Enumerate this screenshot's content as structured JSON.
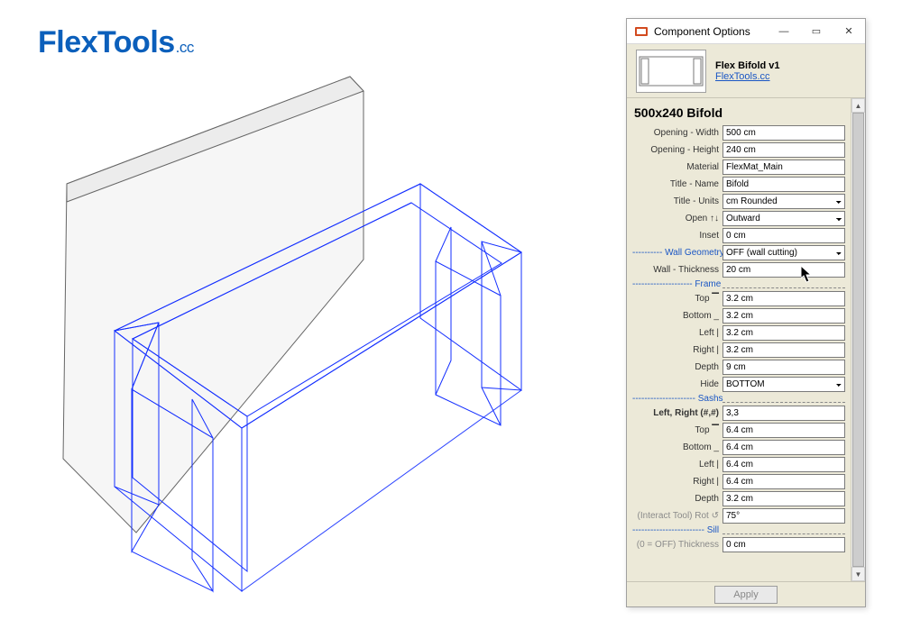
{
  "logo": {
    "main": "FlexTools",
    "suffix": ".cc"
  },
  "window": {
    "title": "Component Options"
  },
  "component": {
    "name": "Flex Bifold v1",
    "link": "FlexTools.cc"
  },
  "section_title": "500x240 Bifold",
  "fields": {
    "opening_width": {
      "label": "Opening - Width",
      "value": "500 cm"
    },
    "opening_height": {
      "label": "Opening - Height",
      "value": "240 cm"
    },
    "material": {
      "label": "Material",
      "value": "FlexMat_Main"
    },
    "title_name": {
      "label": "Title - Name",
      "value": "Bifold"
    },
    "title_units": {
      "label": "Title - Units",
      "value": "cm Rounded"
    },
    "open_dir": {
      "label": "Open ↑↓",
      "value": "Outward"
    },
    "inset": {
      "label": "Inset",
      "value": "0 cm"
    },
    "wall_geom_hdr": {
      "label": "---------- Wall Geometry"
    },
    "wall_geometry": {
      "value": "OFF (wall cutting)"
    },
    "wall_thickness": {
      "label": "Wall - Thickness",
      "value": "20 cm"
    },
    "frame_hdr": {
      "label": "-------------------- Frame"
    },
    "frame_top": {
      "label": "Top ▔",
      "value": "3.2 cm"
    },
    "frame_bottom": {
      "label": "Bottom _",
      "value": "3.2 cm"
    },
    "frame_left": {
      "label": "Left |",
      "value": "3.2 cm"
    },
    "frame_right": {
      "label": "Right |",
      "value": "3.2 cm"
    },
    "frame_depth": {
      "label": "Depth",
      "value": "9 cm"
    },
    "frame_hide": {
      "label": "Hide",
      "value": "BOTTOM"
    },
    "sashs_hdr": {
      "label": "--------------------- Sashs"
    },
    "lr_count": {
      "label": "Left, Right (#,#)",
      "value": "3,3"
    },
    "sash_top": {
      "label": "Top ▔",
      "value": "6.4 cm"
    },
    "sash_bottom": {
      "label": "Bottom _",
      "value": "6.4 cm"
    },
    "sash_left": {
      "label": "Left |",
      "value": "6.4 cm"
    },
    "sash_right": {
      "label": "Right |",
      "value": "6.4 cm"
    },
    "sash_depth": {
      "label": "Depth",
      "value": "3.2 cm"
    },
    "rot": {
      "label": "(Interact Tool) Rot ↺",
      "value": "75°"
    },
    "sill_hdr": {
      "label": "------------------------ Sill"
    },
    "sill_thickness": {
      "label": "(0 = OFF) Thickness",
      "value": "0 cm"
    }
  },
  "apply_label": "Apply"
}
